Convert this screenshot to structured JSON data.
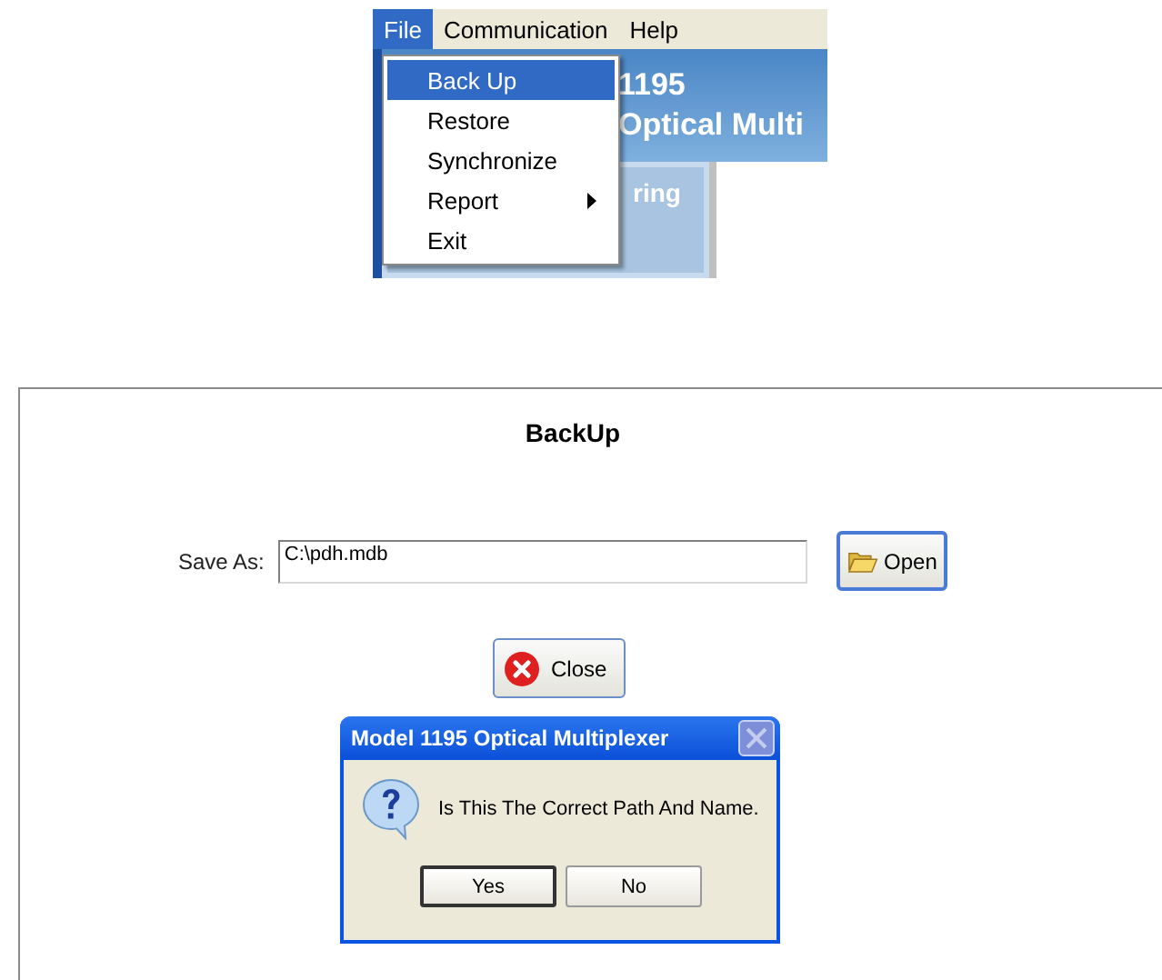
{
  "menubar": [
    {
      "label": "File",
      "selected": true
    },
    {
      "label": "Communication",
      "selected": false
    },
    {
      "label": "Help",
      "selected": false
    }
  ],
  "file_menu": [
    {
      "label": "Back Up",
      "selected": true,
      "submenu": false
    },
    {
      "label": "Restore",
      "selected": false,
      "submenu": false
    },
    {
      "label": "Synchronize",
      "selected": false,
      "submenu": false
    },
    {
      "label": "Report",
      "selected": false,
      "submenu": true
    },
    {
      "label": "Exit",
      "selected": false,
      "submenu": false
    }
  ],
  "background_header": [
    "1195",
    "Optical Multi"
  ],
  "background_nav": [
    "ring"
  ],
  "backup_panel": {
    "title": "BackUp",
    "save_as_label": "Save As:",
    "path": "C:\\pdh.mdb",
    "open_button": "Open",
    "close_button": "Close"
  },
  "dialog": {
    "title": "Model 1195 Optical Multiplexer",
    "message": "Is This The Correct Path And Name.",
    "buttons": [
      {
        "label": "Yes",
        "selected": true
      },
      {
        "label": "No",
        "selected": false
      }
    ]
  }
}
